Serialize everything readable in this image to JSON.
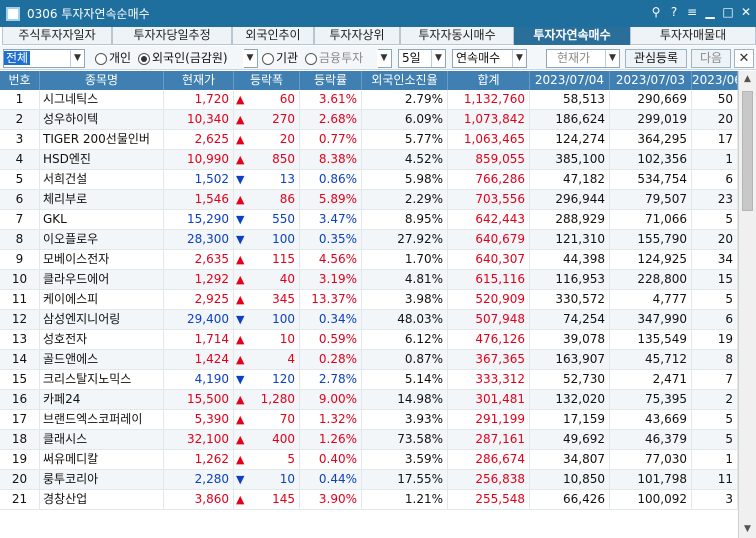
{
  "window": {
    "title": "0306 투자자연속순매수"
  },
  "tabs": [
    {
      "label": "주식투자자일자"
    },
    {
      "label": "투자자당일추정"
    },
    {
      "label": "외국인추이"
    },
    {
      "label": "투자자상위"
    },
    {
      "label": "투자자동시매수"
    },
    {
      "label": "투자자연속매수"
    },
    {
      "label": "투자자매물대"
    }
  ],
  "toolbar": {
    "market_select": "전체",
    "radio_individual": "개인",
    "radio_foreign": "외국인(금감원)",
    "radio_institution": "기관",
    "inst_type_select": "금융투자",
    "days_select": "5일",
    "mode_select": "연속매수",
    "price_select": "현재가",
    "watchlist_button": "관심등록",
    "next_button": "다음",
    "close_glyph": "✕"
  },
  "table": {
    "headers": [
      "번호",
      "종목명",
      "현재가",
      "등락폭",
      "등락률",
      "외국인소진율",
      "합계",
      "2023/07/04",
      "2023/07/03",
      "2023/06"
    ],
    "rows": [
      {
        "no": "1",
        "name": "시그네틱스",
        "price": "1,720",
        "dir": "up",
        "chg": "60",
        "rate": "3.61%",
        "exhaust": "2.79%",
        "total": "1,132,760",
        "d1": "58,513",
        "d2": "290,669",
        "d3": "50"
      },
      {
        "no": "2",
        "name": "성우하이텍",
        "price": "10,340",
        "dir": "up",
        "chg": "270",
        "rate": "2.68%",
        "exhaust": "6.09%",
        "total": "1,073,842",
        "d1": "186,624",
        "d2": "299,019",
        "d3": "20"
      },
      {
        "no": "3",
        "name": "TIGER 200선물인버",
        "price": "2,625",
        "dir": "up",
        "chg": "20",
        "rate": "0.77%",
        "exhaust": "5.77%",
        "total": "1,063,465",
        "d1": "124,274",
        "d2": "364,295",
        "d3": "17"
      },
      {
        "no": "4",
        "name": "HSD엔진",
        "price": "10,990",
        "dir": "up",
        "chg": "850",
        "rate": "8.38%",
        "exhaust": "4.52%",
        "total": "859,055",
        "d1": "385,100",
        "d2": "102,356",
        "d3": "1"
      },
      {
        "no": "5",
        "name": "서희건설",
        "price": "1,502",
        "dir": "down",
        "chg": "13",
        "rate": "0.86%",
        "exhaust": "5.98%",
        "total": "766,286",
        "d1": "47,182",
        "d2": "534,754",
        "d3": "6"
      },
      {
        "no": "6",
        "name": "체리부로",
        "price": "1,546",
        "dir": "up",
        "chg": "86",
        "rate": "5.89%",
        "exhaust": "2.29%",
        "total": "703,556",
        "d1": "296,944",
        "d2": "79,507",
        "d3": "23"
      },
      {
        "no": "7",
        "name": "GKL",
        "price": "15,290",
        "dir": "down",
        "chg": "550",
        "rate": "3.47%",
        "exhaust": "8.95%",
        "total": "642,443",
        "d1": "288,929",
        "d2": "71,066",
        "d3": "5"
      },
      {
        "no": "8",
        "name": "이오플로우",
        "price": "28,300",
        "dir": "down",
        "chg": "100",
        "rate": "0.35%",
        "exhaust": "27.92%",
        "total": "640,679",
        "d1": "121,310",
        "d2": "155,790",
        "d3": "20"
      },
      {
        "no": "9",
        "name": "모베이스전자",
        "price": "2,635",
        "dir": "up",
        "chg": "115",
        "rate": "4.56%",
        "exhaust": "1.70%",
        "total": "640,307",
        "d1": "44,398",
        "d2": "124,925",
        "d3": "34"
      },
      {
        "no": "10",
        "name": "클라우드에어",
        "price": "1,292",
        "dir": "up",
        "chg": "40",
        "rate": "3.19%",
        "exhaust": "4.81%",
        "total": "615,116",
        "d1": "116,953",
        "d2": "228,800",
        "d3": "15"
      },
      {
        "no": "11",
        "name": "케이에스피",
        "price": "2,925",
        "dir": "up",
        "chg": "345",
        "rate": "13.37%",
        "exhaust": "3.98%",
        "total": "520,909",
        "d1": "330,572",
        "d2": "4,777",
        "d3": "5"
      },
      {
        "no": "12",
        "name": "삼성엔지니어링",
        "price": "29,400",
        "dir": "down",
        "chg": "100",
        "rate": "0.34%",
        "exhaust": "48.03%",
        "total": "507,948",
        "d1": "74,254",
        "d2": "347,990",
        "d3": "6"
      },
      {
        "no": "13",
        "name": "성호전자",
        "price": "1,714",
        "dir": "up",
        "chg": "10",
        "rate": "0.59%",
        "exhaust": "6.12%",
        "total": "476,126",
        "d1": "39,078",
        "d2": "135,549",
        "d3": "19"
      },
      {
        "no": "14",
        "name": "골드앤에스",
        "price": "1,424",
        "dir": "up",
        "chg": "4",
        "rate": "0.28%",
        "exhaust": "0.87%",
        "total": "367,365",
        "d1": "163,907",
        "d2": "45,712",
        "d3": "8"
      },
      {
        "no": "15",
        "name": "크리스탈지노믹스",
        "price": "4,190",
        "dir": "down",
        "chg": "120",
        "rate": "2.78%",
        "exhaust": "5.14%",
        "total": "333,312",
        "d1": "52,730",
        "d2": "2,471",
        "d3": "7"
      },
      {
        "no": "16",
        "name": "카페24",
        "price": "15,500",
        "dir": "up",
        "chg": "1,280",
        "rate": "9.00%",
        "exhaust": "14.98%",
        "total": "301,481",
        "d1": "132,020",
        "d2": "75,395",
        "d3": "2"
      },
      {
        "no": "17",
        "name": "브랜드엑스코퍼레이",
        "price": "5,390",
        "dir": "up",
        "chg": "70",
        "rate": "1.32%",
        "exhaust": "3.93%",
        "total": "291,199",
        "d1": "17,159",
        "d2": "43,669",
        "d3": "5"
      },
      {
        "no": "18",
        "name": "클래시스",
        "price": "32,100",
        "dir": "up",
        "chg": "400",
        "rate": "1.26%",
        "exhaust": "73.58%",
        "total": "287,161",
        "d1": "49,692",
        "d2": "46,379",
        "d3": "5"
      },
      {
        "no": "19",
        "name": "써유메디칼",
        "price": "1,262",
        "dir": "up",
        "chg": "5",
        "rate": "0.40%",
        "exhaust": "3.59%",
        "total": "286,674",
        "d1": "34,807",
        "d2": "77,030",
        "d3": "1"
      },
      {
        "no": "20",
        "name": "룽투코리아",
        "price": "2,280",
        "dir": "down",
        "chg": "10",
        "rate": "0.44%",
        "exhaust": "17.55%",
        "total": "256,838",
        "d1": "10,850",
        "d2": "101,798",
        "d3": "11"
      },
      {
        "no": "21",
        "name": "경창산업",
        "price": "3,860",
        "dir": "up",
        "chg": "145",
        "rate": "3.90%",
        "exhaust": "1.21%",
        "total": "255,548",
        "d1": "66,426",
        "d2": "100,092",
        "d3": "3"
      }
    ]
  },
  "colors": {
    "titlebar": "#1f6f9e",
    "tab_active": "#2a6f9a",
    "header_bg": "#3f7fb2",
    "up": "#e3001b",
    "down": "#0a3fc6"
  }
}
